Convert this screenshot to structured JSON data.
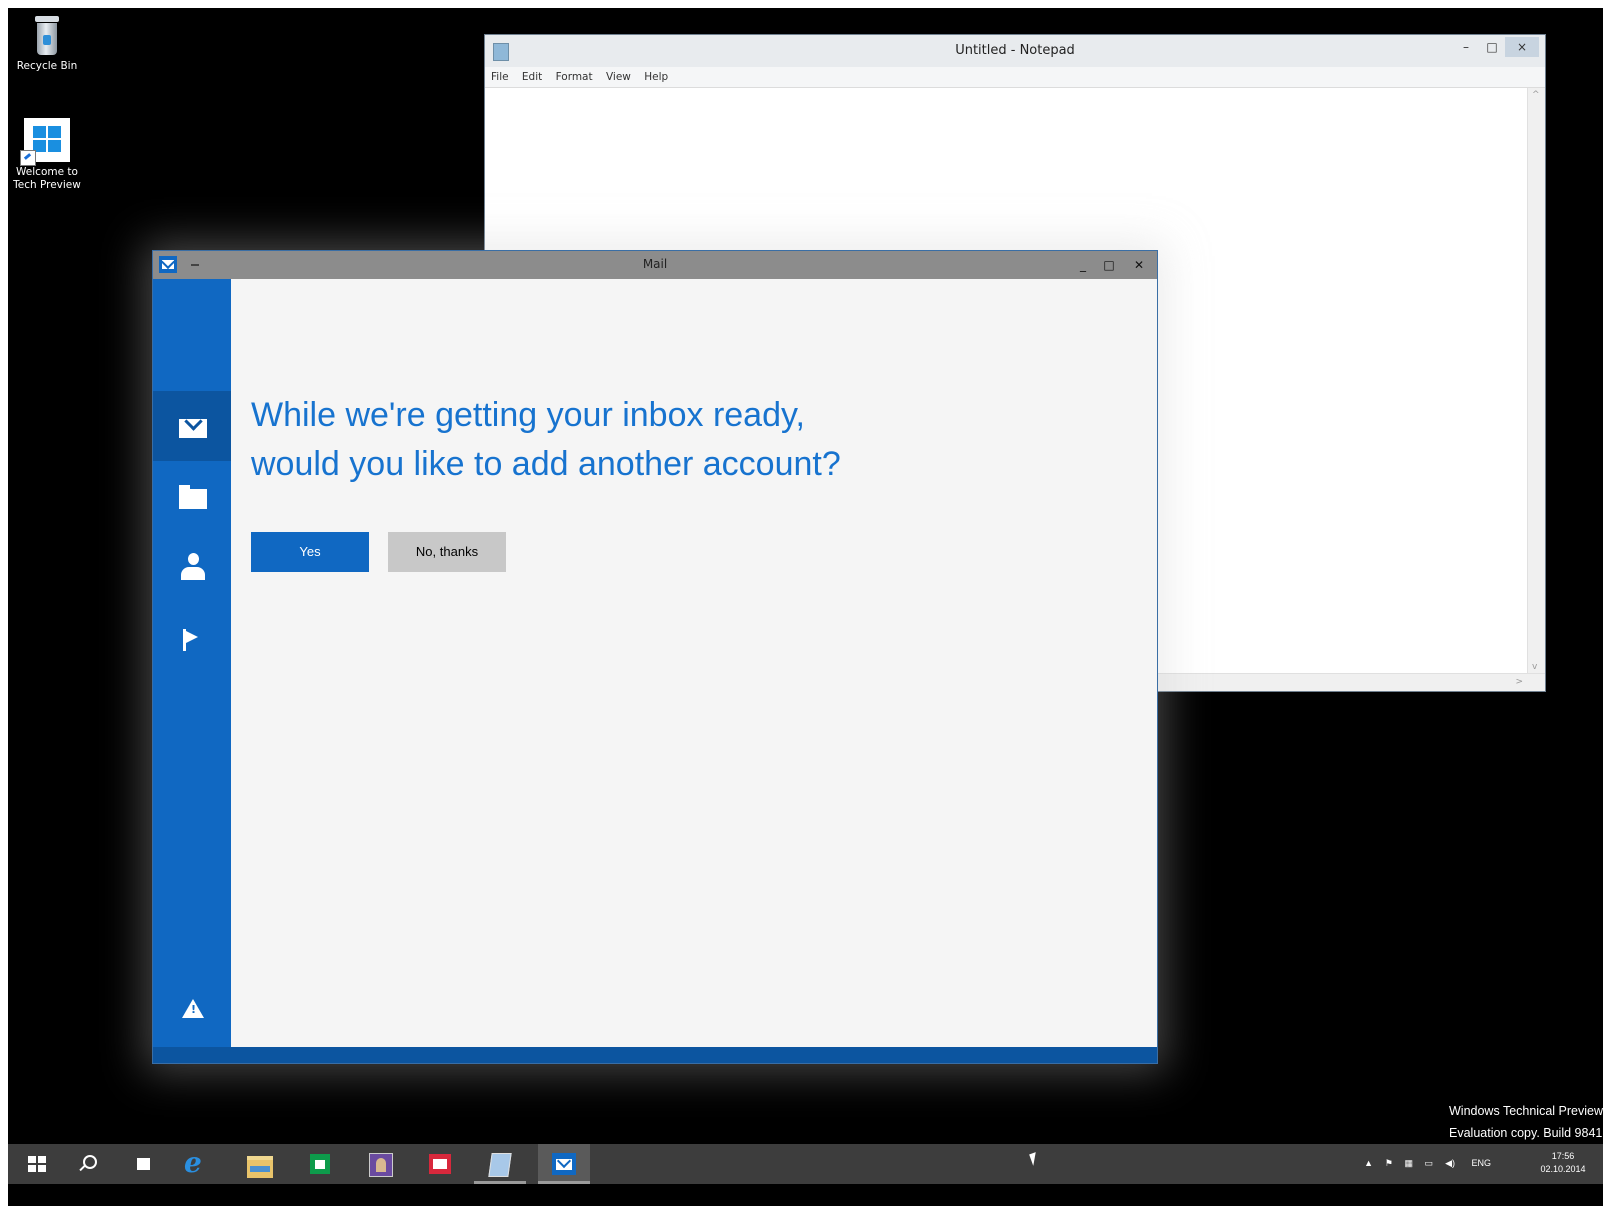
{
  "desktop": {
    "icons": [
      {
        "label": "Recycle Bin",
        "icon": "recycle-bin-icon"
      },
      {
        "label_line1": "Welcome to",
        "label_line2": "Tech Preview",
        "icon": "windows-logo-icon"
      }
    ],
    "watermark": {
      "line1": "Windows Technical Preview",
      "line2": "Evaluation copy. Build 9841"
    }
  },
  "notepad": {
    "title": "Untitled - Notepad",
    "menu": [
      "File",
      "Edit",
      "Format",
      "View",
      "Help"
    ],
    "controls": {
      "minimize": "–",
      "maximize": "□",
      "close": "×"
    }
  },
  "mail": {
    "title": "Mail",
    "controls": {
      "minimize": "_",
      "maximize": "□",
      "close": "✕"
    },
    "sidebar": [
      {
        "name": "mail",
        "icon": "envelope-icon",
        "active": true
      },
      {
        "name": "folders",
        "icon": "folder-icon",
        "active": false
      },
      {
        "name": "people",
        "icon": "person-icon",
        "active": false
      },
      {
        "name": "flagged",
        "icon": "flag-icon",
        "active": false
      },
      {
        "name": "alerts",
        "icon": "warning-icon",
        "active": false
      }
    ],
    "prompt_line1": "While we're getting your inbox ready,",
    "prompt_line2": "would you like to add another account?",
    "yes_label": "Yes",
    "no_label": "No, thanks",
    "colors": {
      "accent": "#1068c2",
      "prompt_text": "#1773cf",
      "secondary_button": "#c8c8c8"
    }
  },
  "taskbar": {
    "items": [
      {
        "name": "start",
        "icon": "windows-logo-icon"
      },
      {
        "name": "search",
        "icon": "search-icon"
      },
      {
        "name": "task-view",
        "icon": "task-view-icon"
      },
      {
        "name": "internet-explorer",
        "icon": "ie-icon"
      },
      {
        "name": "file-explorer",
        "icon": "folder-icon"
      },
      {
        "name": "store",
        "icon": "store-icon"
      },
      {
        "name": "photos",
        "icon": "photo-icon"
      },
      {
        "name": "news",
        "icon": "news-icon"
      },
      {
        "name": "notepad",
        "icon": "notepad-icon"
      },
      {
        "name": "mail",
        "icon": "mail-icon"
      }
    ],
    "tray": {
      "language": "ENG",
      "time": "17:56",
      "date": "02.10.2014",
      "icons": [
        "chevron-up-icon",
        "flag-icon",
        "network-icon",
        "monitor-icon",
        "volume-icon"
      ]
    }
  }
}
